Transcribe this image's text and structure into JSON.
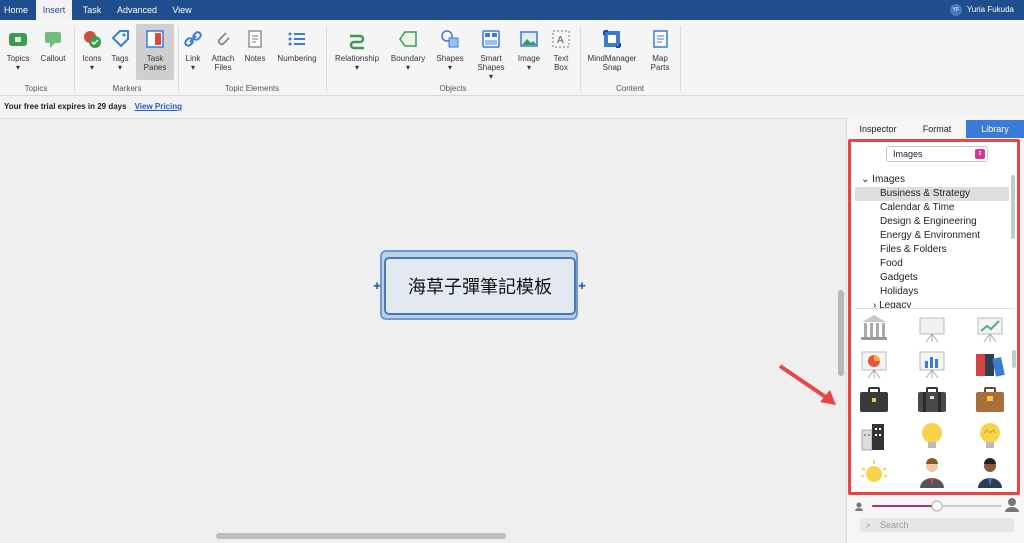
{
  "menu": {
    "tabs": [
      "Home",
      "Insert",
      "Task",
      "Advanced",
      "View"
    ],
    "active_tab": "Insert",
    "user_initials": "YF",
    "user_name": "Yuria Fukuda"
  },
  "ribbon": {
    "buttons": {
      "topics": "Topics",
      "callout": "Callout",
      "icons": "Icons",
      "tags": "Tags",
      "task_panes": "Task Panes",
      "link": "Link",
      "attach_files": "Attach Files",
      "notes": "Notes",
      "numbering": "Numbering",
      "relationship": "Relationship",
      "boundary": "Boundary",
      "shapes": "Shapes",
      "smart_shapes": "Smart Shapes",
      "image": "Image",
      "text_box": "Text Box",
      "mindmanager_snap": "MindManager Snap",
      "map_parts": "Map Parts"
    },
    "groups": {
      "topics": "Topics",
      "markers": "Markers",
      "topic_elements": "Topic Elements",
      "objects": "Objects",
      "content": "Content"
    }
  },
  "trial": {
    "message": "Your free trial expires in 29 days",
    "link": "View Pricing"
  },
  "canvas": {
    "central_topic": "海草子彈筆記模板"
  },
  "panel": {
    "tabs": [
      "Inspector",
      "Format",
      "Library"
    ],
    "active_tab": "Library",
    "dropdown_value": "Images",
    "tree_root": "Images",
    "tree_items": [
      "Business & Strategy",
      "Calendar & Time",
      "Design & Engineering",
      "Energy & Environment",
      "Files & Folders",
      "Food",
      "Gadgets",
      "Holidays",
      "Legacy"
    ],
    "selected_item": "Business & Strategy",
    "search_placeholder": "Search",
    "thumbnail_size_level": 0.5
  },
  "colors": {
    "title_bar": "#1f4d8d",
    "accent": "#3a7bd5",
    "highlight_frame": "#e84545",
    "topic_border": "#4d78b6"
  },
  "icons": {
    "library_images": [
      "bank-building-icon",
      "presentation-board-icon",
      "growth-chart-board-icon",
      "pie-chart-board-icon",
      "bar-chart-board-icon",
      "binders-icon",
      "briefcase-dark-icon",
      "briefcase-gray-icon",
      "briefcase-brown-icon",
      "office-buildings-icon",
      "lightbulb-icon",
      "lightbulb-idea-icon",
      "lightbulb-glow-icon",
      "businessman-icon",
      "businessman-dark-icon"
    ]
  }
}
